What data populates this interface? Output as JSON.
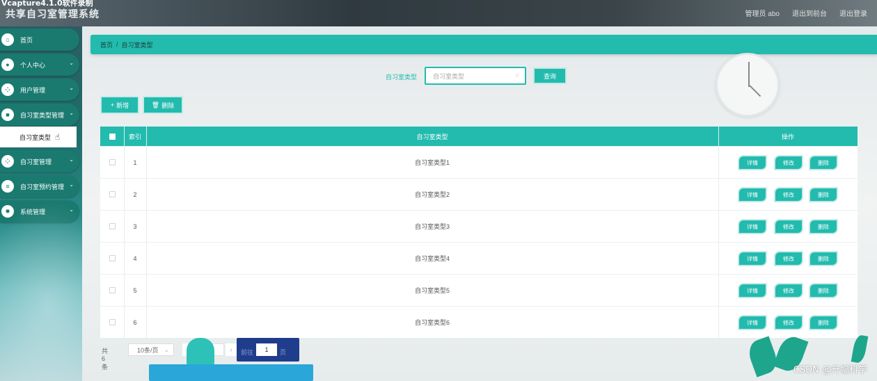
{
  "header": {
    "watermark": "Vcapture4.1.0软件录制",
    "title": "共享自习室管理系统",
    "links": [
      "管理员 abo",
      "退出到前台",
      "退出登录"
    ]
  },
  "sidebar": {
    "items": [
      {
        "label": "首页",
        "icon": "home-icon",
        "arrow": false
      },
      {
        "label": "个人中心",
        "icon": "user-icon",
        "arrow": true
      },
      {
        "label": "用户管理",
        "icon": "grid-icon",
        "arrow": true
      },
      {
        "label": "自习室类型管理",
        "icon": "bag-icon",
        "arrow": true
      },
      {
        "label": "自习室管理",
        "icon": "grid-icon",
        "arrow": true
      },
      {
        "label": "自习室预约管理",
        "icon": "list-icon",
        "arrow": true
      },
      {
        "label": "系统管理",
        "icon": "settings-icon",
        "arrow": true
      }
    ],
    "active_sub": "自习室类型"
  },
  "breadcrumb": {
    "home": "首页",
    "separator": "/",
    "current": "自习室类型"
  },
  "search": {
    "label": "自习室类型",
    "placeholder": "自习室类型",
    "button": "查询"
  },
  "toolbar": {
    "add": "新增",
    "delete": "删除"
  },
  "table": {
    "headers": {
      "index": "索引",
      "type": "自习室类型",
      "ops": "操作"
    },
    "rows": [
      {
        "index": "1",
        "type": "自习室类型1"
      },
      {
        "index": "2",
        "type": "自习室类型2"
      },
      {
        "index": "3",
        "type": "自习室类型3"
      },
      {
        "index": "4",
        "type": "自习室类型4"
      },
      {
        "index": "5",
        "type": "自习室类型5"
      },
      {
        "index": "6",
        "type": "自习室类型6"
      }
    ],
    "ops": {
      "detail": "详情",
      "edit": "修改",
      "delete": "删除"
    }
  },
  "pager": {
    "total": "共 6 条",
    "page_size": "10条/页",
    "prev": "‹",
    "next": "›",
    "current": "1",
    "goto_prefix": "前往",
    "goto_value": "1",
    "goto_suffix": "页"
  },
  "watermark_bottom": "CSDN @升幅科学",
  "colors": {
    "accent": "#22bbae",
    "sidebar": "#1a7a70"
  }
}
